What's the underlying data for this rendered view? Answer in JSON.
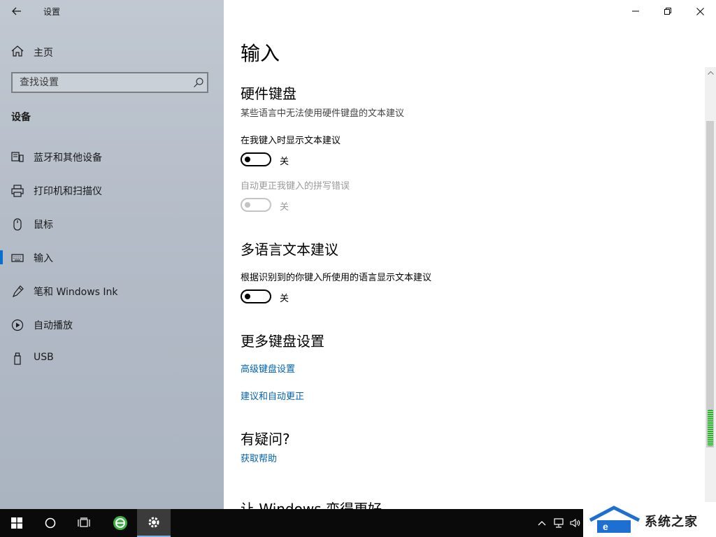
{
  "app": {
    "title": "设置"
  },
  "sidebar": {
    "home_label": "主页",
    "search_placeholder": "查找设置",
    "section": "设备",
    "items": [
      {
        "label": "蓝牙和其他设备",
        "icon": "bluetooth-devices-icon"
      },
      {
        "label": "打印机和扫描仪",
        "icon": "printer-icon"
      },
      {
        "label": "鼠标",
        "icon": "mouse-icon"
      },
      {
        "label": "输入",
        "icon": "keyboard-icon",
        "active": true
      },
      {
        "label": "笔和 Windows Ink",
        "icon": "pen-icon"
      },
      {
        "label": "自动播放",
        "icon": "autoplay-icon"
      },
      {
        "label": "USB",
        "icon": "usb-icon"
      }
    ]
  },
  "main": {
    "title": "输入",
    "hardware": {
      "heading": "硬件键盘",
      "description": "某些语言中无法使用硬件键盘的文本建议",
      "opt1_label": "在我键入时显示文本建议",
      "opt1_state": "关",
      "opt2_label": "自动更正我键入的拼写错误",
      "opt2_state": "关"
    },
    "multilang": {
      "heading": "多语言文本建议",
      "opt_label": "根据识别到的你键入所使用的语言显示文本建议",
      "opt_state": "关"
    },
    "more": {
      "heading": "更多键盘设置",
      "link1": "高级键盘设置",
      "link2": "建议和自动更正"
    },
    "question": {
      "heading": "有疑问?",
      "link": "获取帮助"
    },
    "better": {
      "heading": "让 Windows 变得更好"
    }
  },
  "brand": {
    "text": "系统之家"
  },
  "colors": {
    "accent": "#0063b1",
    "sidebar_bg": "#b4bcc8",
    "taskbar": "#0a0a0a"
  }
}
